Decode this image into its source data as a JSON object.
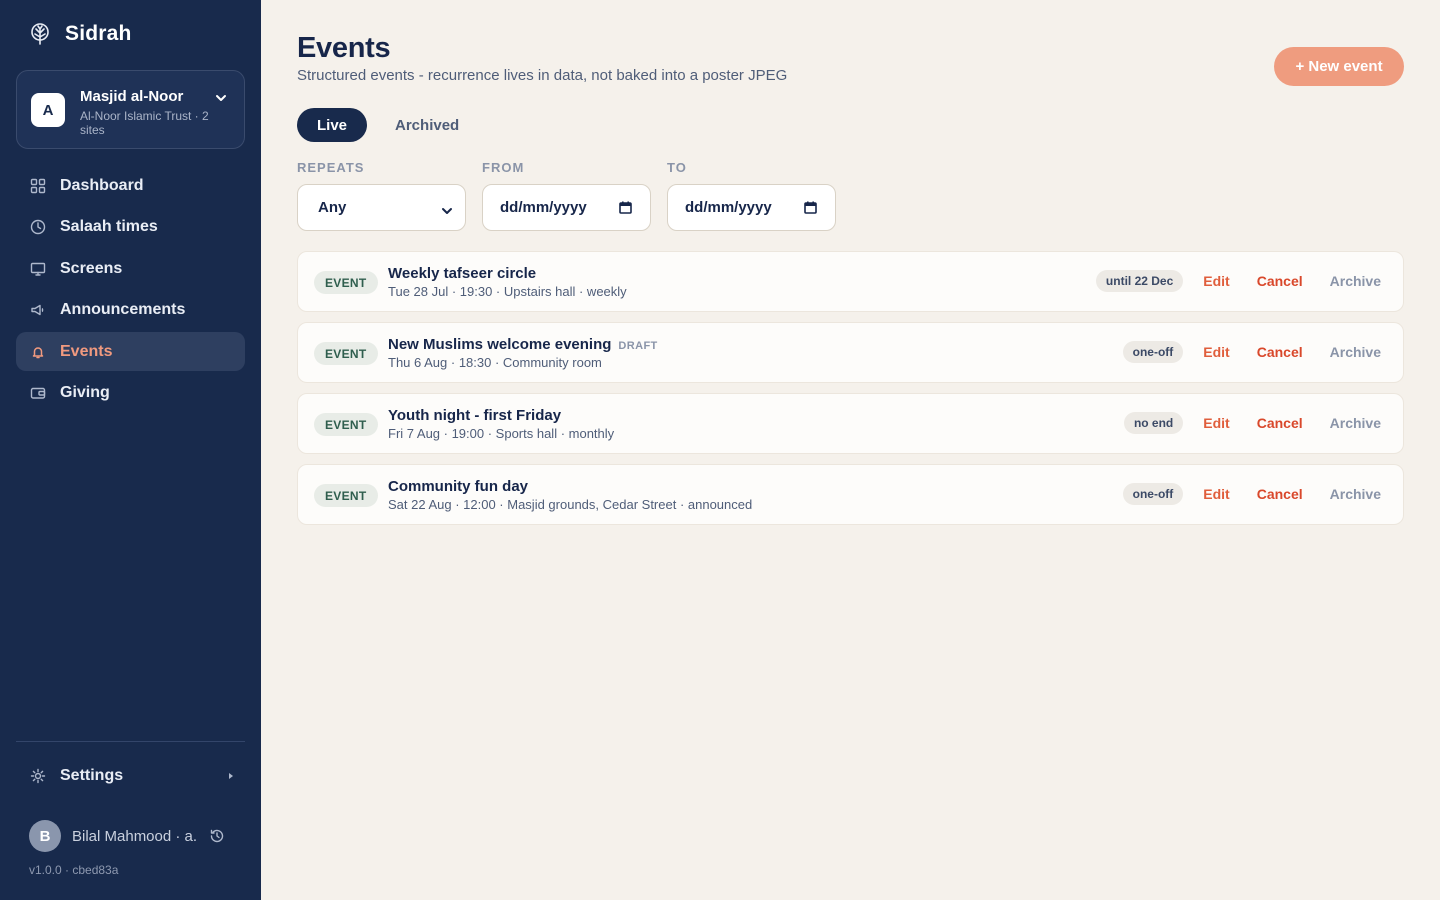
{
  "app": {
    "name": "Sidrah",
    "version": "v1.0.0 · cbed83a"
  },
  "org": {
    "avatar_letter": "A",
    "name": "Masjid al-Noor",
    "subtitle": "Al-Noor Islamic Trust · 2 sites"
  },
  "nav": {
    "items": [
      {
        "label": "Dashboard",
        "icon": "grid-icon",
        "active": false
      },
      {
        "label": "Salaah times",
        "icon": "clock-icon",
        "active": false
      },
      {
        "label": "Screens",
        "icon": "monitor-icon",
        "active": false
      },
      {
        "label": "Announcements",
        "icon": "megaphone-icon",
        "active": false
      },
      {
        "label": "Events",
        "icon": "bell-icon",
        "active": true
      },
      {
        "label": "Giving",
        "icon": "wallet-icon",
        "active": false
      }
    ],
    "settings_label": "Settings"
  },
  "user": {
    "avatar_letter": "B",
    "name": "Bilal Mahmood · a..."
  },
  "page": {
    "title": "Events",
    "subtitle": "Structured events - recurrence lives in data, not baked into a poster JPEG",
    "new_button": "+ New event"
  },
  "tabs": [
    {
      "label": "Live",
      "active": true
    },
    {
      "label": "Archived",
      "active": false
    }
  ],
  "filters": {
    "repeats": {
      "label": "REPEATS",
      "value": "Any"
    },
    "from": {
      "label": "FROM",
      "value": "dd/mm/yyyy"
    },
    "to": {
      "label": "TO",
      "value": "dd/mm/yyyy"
    }
  },
  "events": [
    {
      "badge": "EVENT",
      "title": "Weekly tafseer circle",
      "draft": "",
      "meta": "Tue 28 Jul · 19:30 · Upstairs hall · weekly",
      "pill": "until 22 Dec",
      "edit": "Edit",
      "cancel": "Cancel",
      "archive": "Archive"
    },
    {
      "badge": "EVENT",
      "title": "New Muslims welcome evening",
      "draft": "DRAFT",
      "meta": "Thu 6 Aug · 18:30 · Community room",
      "pill": "one-off",
      "edit": "Edit",
      "cancel": "Cancel",
      "archive": "Archive"
    },
    {
      "badge": "EVENT",
      "title": "Youth night - first Friday",
      "draft": "",
      "meta": "Fri 7 Aug · 19:00 · Sports hall · monthly",
      "pill": "no end",
      "edit": "Edit",
      "cancel": "Cancel",
      "archive": "Archive"
    },
    {
      "badge": "EVENT",
      "title": "Community fun day",
      "draft": "",
      "meta": "Sat 22 Aug · 12:00 · Masjid grounds, Cedar Street · announced",
      "pill": "one-off",
      "edit": "Edit",
      "cancel": "Cancel",
      "archive": "Archive"
    }
  ],
  "colors": {
    "sidebar": "#182a4c",
    "accent": "#ef9c7f",
    "cancel": "#d9482b",
    "background": "#f5f1eb"
  }
}
